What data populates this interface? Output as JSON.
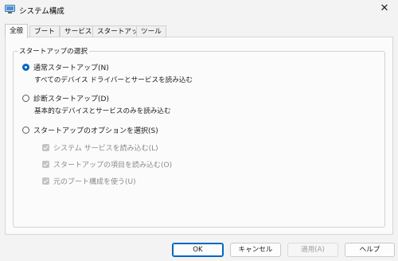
{
  "window": {
    "title": "システム構成"
  },
  "tabs": [
    {
      "label": "全般",
      "active": true
    },
    {
      "label": "ブート",
      "active": false
    },
    {
      "label": "サービス",
      "active": false
    },
    {
      "label": "スタートアップ",
      "active": false
    },
    {
      "label": "ツール",
      "active": false
    }
  ],
  "startup_selection": {
    "legend": "スタートアップの選択",
    "normal": {
      "label": "通常スタートアップ(N)",
      "description": "すべてのデバイス ドライバーとサービスを読み込む",
      "checked": true
    },
    "diagnostic": {
      "label": "診断スタートアップ(D)",
      "description": "基本的なデバイスとサービスのみを読み込む",
      "checked": false
    },
    "selective": {
      "label": "スタートアップのオプションを選択(S)",
      "checked": false,
      "options": [
        {
          "label": "システム サービスを読み込む(L)",
          "checked": true,
          "enabled": false
        },
        {
          "label": "スタートアップの項目を読み込む(O)",
          "checked": true,
          "enabled": false
        },
        {
          "label": "元のブート構成を使う(U)",
          "checked": true,
          "enabled": false
        }
      ]
    }
  },
  "buttons": {
    "ok": "OK",
    "cancel": "キャンセル",
    "apply": "適用(A)",
    "help": "ヘルプ"
  },
  "colors": {
    "accent": "#0067c0",
    "disabled_text": "#8a8a8a"
  }
}
